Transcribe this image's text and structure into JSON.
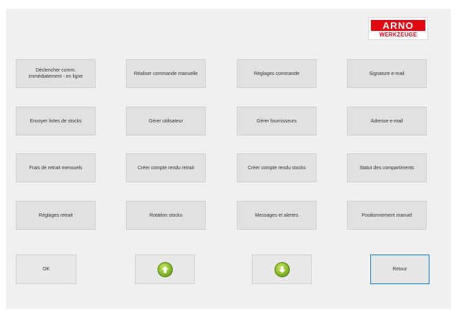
{
  "logo": {
    "top": "ARNO",
    "bottom": "WERKZEUGE"
  },
  "buttons": {
    "r1": [
      "Déclencher comm. immédiatement - en ligne",
      "Réaliser commande manuelle",
      "Réglages commande",
      "Signature e-mail"
    ],
    "r2": [
      "Envoyer listes de stocks",
      "Gérer utilisateur",
      "Gérer fournisseurs",
      "Adresse e-mail"
    ],
    "r3": [
      "Frais de retrait mensuels",
      "Créer compte rendu retrait",
      "Créer compte rendu stocks",
      "Statut des compartiments"
    ],
    "r4": [
      "Réglages retrait",
      "Rotation stocks",
      "Messages et alertes",
      "Positionnement manuel"
    ]
  },
  "bottom": {
    "ok": "OK",
    "up_icon": "arrow-up-icon",
    "down_icon": "arrow-down-icon",
    "back": "Retour"
  },
  "colors": {
    "brand_red": "#e30613",
    "arrow_green": "#6fa61c",
    "focus_blue": "#0078d7"
  }
}
